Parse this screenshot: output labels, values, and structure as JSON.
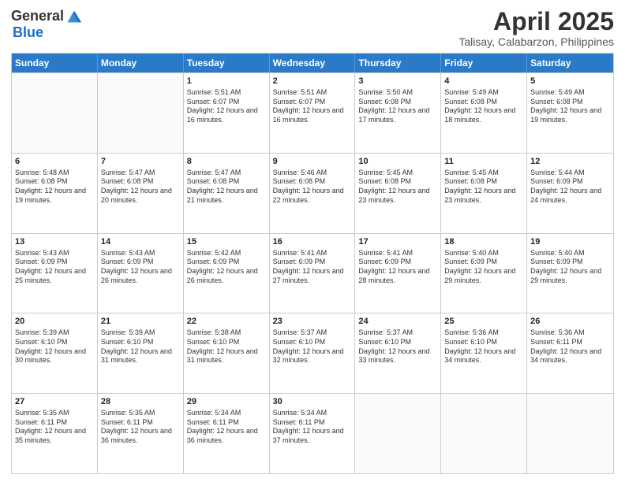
{
  "logo": {
    "general": "General",
    "blue": "Blue"
  },
  "title": "April 2025",
  "subtitle": "Talisay, Calabarzon, Philippines",
  "headers": [
    "Sunday",
    "Monday",
    "Tuesday",
    "Wednesday",
    "Thursday",
    "Friday",
    "Saturday"
  ],
  "rows": [
    [
      {
        "day": "",
        "info": ""
      },
      {
        "day": "",
        "info": ""
      },
      {
        "day": "1",
        "info": "Sunrise: 5:51 AM\nSunset: 6:07 PM\nDaylight: 12 hours and 16 minutes."
      },
      {
        "day": "2",
        "info": "Sunrise: 5:51 AM\nSunset: 6:07 PM\nDaylight: 12 hours and 16 minutes."
      },
      {
        "day": "3",
        "info": "Sunrise: 5:50 AM\nSunset: 6:08 PM\nDaylight: 12 hours and 17 minutes."
      },
      {
        "day": "4",
        "info": "Sunrise: 5:49 AM\nSunset: 6:08 PM\nDaylight: 12 hours and 18 minutes."
      },
      {
        "day": "5",
        "info": "Sunrise: 5:49 AM\nSunset: 6:08 PM\nDaylight: 12 hours and 19 minutes."
      }
    ],
    [
      {
        "day": "6",
        "info": "Sunrise: 5:48 AM\nSunset: 6:08 PM\nDaylight: 12 hours and 19 minutes."
      },
      {
        "day": "7",
        "info": "Sunrise: 5:47 AM\nSunset: 6:08 PM\nDaylight: 12 hours and 20 minutes."
      },
      {
        "day": "8",
        "info": "Sunrise: 5:47 AM\nSunset: 6:08 PM\nDaylight: 12 hours and 21 minutes."
      },
      {
        "day": "9",
        "info": "Sunrise: 5:46 AM\nSunset: 6:08 PM\nDaylight: 12 hours and 22 minutes."
      },
      {
        "day": "10",
        "info": "Sunrise: 5:45 AM\nSunset: 6:08 PM\nDaylight: 12 hours and 23 minutes."
      },
      {
        "day": "11",
        "info": "Sunrise: 5:45 AM\nSunset: 6:08 PM\nDaylight: 12 hours and 23 minutes."
      },
      {
        "day": "12",
        "info": "Sunrise: 5:44 AM\nSunset: 6:09 PM\nDaylight: 12 hours and 24 minutes."
      }
    ],
    [
      {
        "day": "13",
        "info": "Sunrise: 5:43 AM\nSunset: 6:09 PM\nDaylight: 12 hours and 25 minutes."
      },
      {
        "day": "14",
        "info": "Sunrise: 5:43 AM\nSunset: 6:09 PM\nDaylight: 12 hours and 26 minutes."
      },
      {
        "day": "15",
        "info": "Sunrise: 5:42 AM\nSunset: 6:09 PM\nDaylight: 12 hours and 26 minutes."
      },
      {
        "day": "16",
        "info": "Sunrise: 5:41 AM\nSunset: 6:09 PM\nDaylight: 12 hours and 27 minutes."
      },
      {
        "day": "17",
        "info": "Sunrise: 5:41 AM\nSunset: 6:09 PM\nDaylight: 12 hours and 28 minutes."
      },
      {
        "day": "18",
        "info": "Sunrise: 5:40 AM\nSunset: 6:09 PM\nDaylight: 12 hours and 29 minutes."
      },
      {
        "day": "19",
        "info": "Sunrise: 5:40 AM\nSunset: 6:09 PM\nDaylight: 12 hours and 29 minutes."
      }
    ],
    [
      {
        "day": "20",
        "info": "Sunrise: 5:39 AM\nSunset: 6:10 PM\nDaylight: 12 hours and 30 minutes."
      },
      {
        "day": "21",
        "info": "Sunrise: 5:39 AM\nSunset: 6:10 PM\nDaylight: 12 hours and 31 minutes."
      },
      {
        "day": "22",
        "info": "Sunrise: 5:38 AM\nSunset: 6:10 PM\nDaylight: 12 hours and 31 minutes."
      },
      {
        "day": "23",
        "info": "Sunrise: 5:37 AM\nSunset: 6:10 PM\nDaylight: 12 hours and 32 minutes."
      },
      {
        "day": "24",
        "info": "Sunrise: 5:37 AM\nSunset: 6:10 PM\nDaylight: 12 hours and 33 minutes."
      },
      {
        "day": "25",
        "info": "Sunrise: 5:36 AM\nSunset: 6:10 PM\nDaylight: 12 hours and 34 minutes."
      },
      {
        "day": "26",
        "info": "Sunrise: 5:36 AM\nSunset: 6:11 PM\nDaylight: 12 hours and 34 minutes."
      }
    ],
    [
      {
        "day": "27",
        "info": "Sunrise: 5:35 AM\nSunset: 6:11 PM\nDaylight: 12 hours and 35 minutes."
      },
      {
        "day": "28",
        "info": "Sunrise: 5:35 AM\nSunset: 6:11 PM\nDaylight: 12 hours and 36 minutes."
      },
      {
        "day": "29",
        "info": "Sunrise: 5:34 AM\nSunset: 6:11 PM\nDaylight: 12 hours and 36 minutes."
      },
      {
        "day": "30",
        "info": "Sunrise: 5:34 AM\nSunset: 6:11 PM\nDaylight: 12 hours and 37 minutes."
      },
      {
        "day": "",
        "info": ""
      },
      {
        "day": "",
        "info": ""
      },
      {
        "day": "",
        "info": ""
      }
    ]
  ]
}
